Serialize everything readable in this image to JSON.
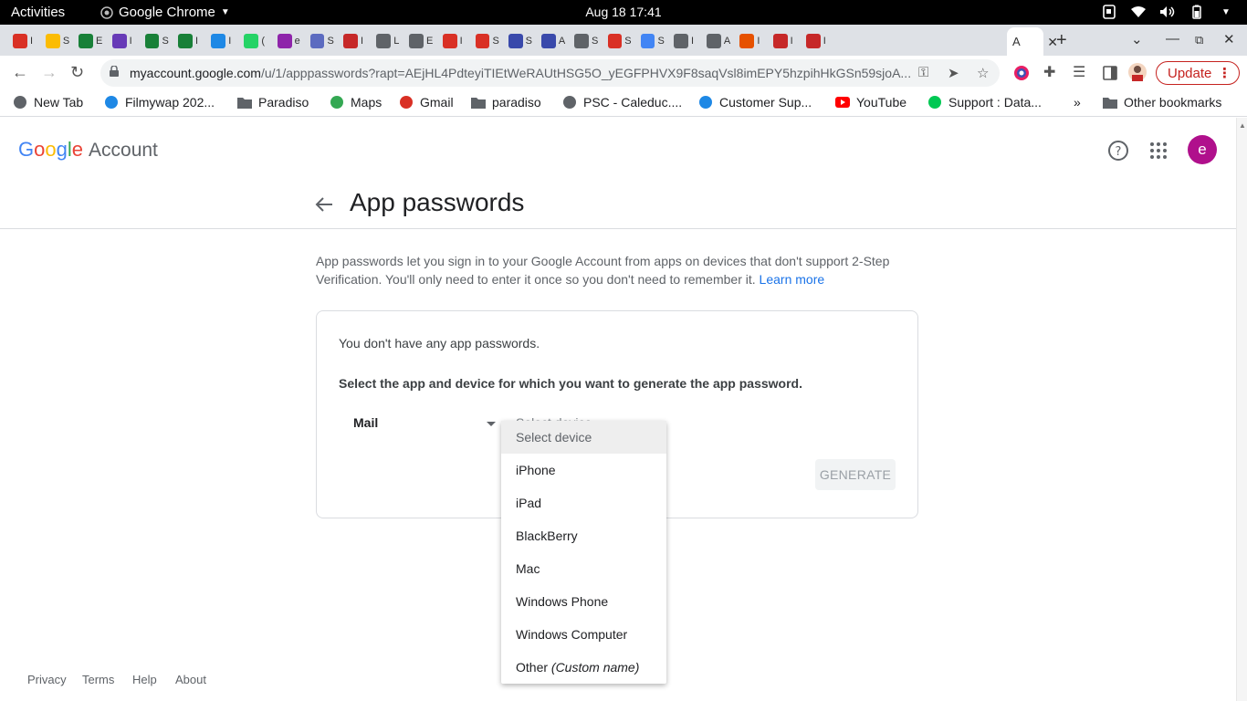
{
  "system": {
    "activities": "Activities",
    "app_name": "Google Chrome",
    "clock": "Aug 18  17:41"
  },
  "tabs": [
    {
      "icon": "gmail-icon",
      "color": "#d93025",
      "letter": "I"
    },
    {
      "icon": "drive-icon",
      "color": "#fbbc04",
      "letter": "S"
    },
    {
      "icon": "sheets-icon",
      "color": "#188038",
      "letter": "E"
    },
    {
      "icon": "forms-icon",
      "color": "#673ab7",
      "letter": "I"
    },
    {
      "icon": "sheets-icon",
      "color": "#188038",
      "letter": "S"
    },
    {
      "icon": "sheets-icon",
      "color": "#188038",
      "letter": "I"
    },
    {
      "icon": "appstore-icon",
      "color": "#1e88e5",
      "letter": "I"
    },
    {
      "icon": "whatsapp-icon",
      "color": "#25d366",
      "letter": "("
    },
    {
      "icon": "app-icon",
      "color": "#8e24aa",
      "letter": "e"
    },
    {
      "icon": "app-icon",
      "color": "#5c6bc0",
      "letter": "S"
    },
    {
      "icon": "app-icon",
      "color": "#c62828",
      "letter": "I"
    },
    {
      "icon": "doc-icon",
      "color": "#5f6368",
      "letter": "L"
    },
    {
      "icon": "doc-icon",
      "color": "#5f6368",
      "letter": "E"
    },
    {
      "icon": "gmail-icon",
      "color": "#d93025",
      "letter": "I"
    },
    {
      "icon": "gmail-icon",
      "color": "#d93025",
      "letter": "S"
    },
    {
      "icon": "hex-icon",
      "color": "#3949ab",
      "letter": "S"
    },
    {
      "icon": "hex-icon",
      "color": "#3949ab",
      "letter": "A"
    },
    {
      "icon": "globe-icon",
      "color": "#5f6368",
      "letter": "S"
    },
    {
      "icon": "gmail-icon",
      "color": "#d93025",
      "letter": "S"
    },
    {
      "icon": "google-icon",
      "color": "#4285f4",
      "letter": "S"
    },
    {
      "icon": "globe-icon",
      "color": "#5f6368",
      "letter": "I"
    },
    {
      "icon": "globe-icon",
      "color": "#5f6368",
      "letter": "A"
    },
    {
      "icon": "app-icon",
      "color": "#e65100",
      "letter": "I"
    },
    {
      "icon": "app-icon",
      "color": "#c62828",
      "letter": "I"
    },
    {
      "icon": "app-icon",
      "color": "#c62828",
      "letter": "I"
    }
  ],
  "active_tab": {
    "letter": "A"
  },
  "omnibox": {
    "host": "myaccount.google.com",
    "path": "/u/1/apppasswords?rapt=AEjHL4PdteyiTIEtWeRAUtHSG5O_yEGFPHVX9F8saqVsl8imEPY5hzpihHkGSn59sjoA..."
  },
  "update_label": "Update",
  "bookmarks": [
    {
      "label": "New Tab",
      "icon": "globe-icon"
    },
    {
      "label": "Filmywap 202...",
      "icon": "filmywap-icon"
    },
    {
      "label": "Paradiso",
      "icon": "folder-icon"
    },
    {
      "label": "Maps",
      "icon": "maps-icon"
    },
    {
      "label": "Gmail",
      "icon": "gmail-icon"
    },
    {
      "label": "paradiso",
      "icon": "folder-icon"
    },
    {
      "label": "PSC - Caleduc....",
      "icon": "globe-icon"
    },
    {
      "label": "Customer Sup...",
      "icon": "drupal-icon"
    },
    {
      "label": "YouTube",
      "icon": "youtube-icon"
    },
    {
      "label": "Support : Data...",
      "icon": "support-icon"
    }
  ],
  "bookmarks_more": "»",
  "other_bookmarks": "Other bookmarks",
  "page": {
    "logo_google": "Google",
    "logo_account": "Account",
    "avatar_letter": "e",
    "title": "App passwords",
    "desc": "App passwords let you sign in to your Google Account from apps on devices that don't support 2-Step Verification. You'll only need to enter it once so you don't need to remember it.",
    "learn_more": "Learn more",
    "no_passwords": "You don't have any app passwords.",
    "select_text": "Select the app and device for which you want to generate the app password.",
    "app_value": "Mail",
    "device_placeholder": "Select device",
    "generate": "GENERATE"
  },
  "dropdown": {
    "items": [
      {
        "label": "Select device",
        "selected": true
      },
      {
        "label": "iPhone"
      },
      {
        "label": "iPad"
      },
      {
        "label": "BlackBerry"
      },
      {
        "label": "Mac"
      },
      {
        "label": "Windows Phone"
      },
      {
        "label": "Windows Computer"
      }
    ],
    "other_label": "Other",
    "other_hint": "(Custom name)"
  },
  "footer": {
    "privacy": "Privacy",
    "terms": "Terms",
    "help": "Help",
    "about": "About"
  },
  "colors": {
    "accent": "#1a73e8",
    "avatar": "#b0108c",
    "update": "#c5221f"
  }
}
